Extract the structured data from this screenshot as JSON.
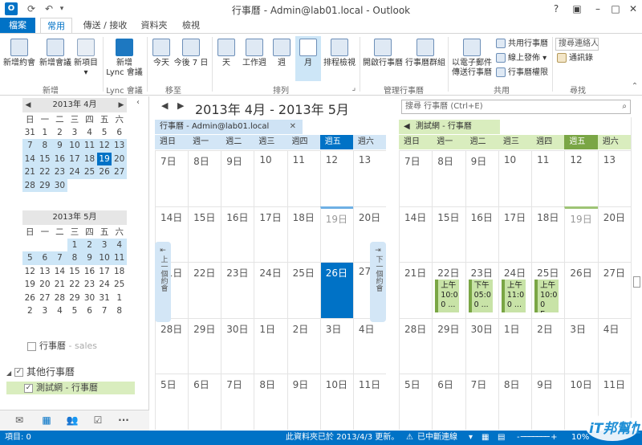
{
  "window": {
    "title": "行事曆 - Admin@lab01.local - Outlook",
    "app_icon": "O",
    "buttons": [
      "?",
      "▣",
      "–",
      "□",
      "✕"
    ]
  },
  "tabs": [
    {
      "label": "檔案"
    },
    {
      "label": "常用"
    },
    {
      "label": "傳送 / 接收"
    },
    {
      "label": "資料夾"
    },
    {
      "label": "檢視"
    }
  ],
  "ribbon": {
    "new_group": {
      "label": "新增",
      "buttons": [
        "新增約會",
        "新增會議",
        "新項目"
      ]
    },
    "lync_group": {
      "label": "Lync 會議",
      "buttons": [
        "新增",
        "Lync 會議"
      ]
    },
    "goto_group": {
      "label": "移至",
      "buttons": [
        "今天",
        "今後 7 日"
      ]
    },
    "arrange_group": {
      "label": "排列",
      "buttons": [
        "天",
        "工作週",
        "週",
        "月",
        "排程檢視"
      ]
    },
    "manage_group": {
      "label": "管理行事曆",
      "buttons": [
        "開啟行事曆",
        "行事曆群組"
      ]
    },
    "share_group": {
      "label": "共用",
      "buttons": [
        "以電子郵件",
        "傳送行事曆"
      ],
      "small": [
        "共用行事曆",
        "線上發佈",
        "行事曆權限"
      ]
    },
    "find_group": {
      "label": "尋找",
      "search": "搜尋連絡人",
      "addressbook": "通訊錄"
    }
  },
  "mini_april": {
    "title": "2013年 4月",
    "weekdays": [
      "日",
      "一",
      "二",
      "三",
      "四",
      "五",
      "六"
    ],
    "rows": [
      [
        "31",
        "1",
        "2",
        "3",
        "4",
        "5",
        "6"
      ],
      [
        "7",
        "8",
        "9",
        "10",
        "11",
        "12",
        "13"
      ],
      [
        "14",
        "15",
        "16",
        "17",
        "18",
        "19",
        "20"
      ],
      [
        "21",
        "22",
        "23",
        "24",
        "25",
        "26",
        "27"
      ],
      [
        "28",
        "29",
        "30",
        "",
        "",
        "",
        ""
      ]
    ]
  },
  "mini_may": {
    "title": "2013年 5月",
    "weekdays": [
      "日",
      "一",
      "二",
      "三",
      "四",
      "五",
      "六"
    ],
    "rows": [
      [
        "",
        "",
        "",
        "1",
        "2",
        "3",
        "4"
      ],
      [
        "5",
        "6",
        "7",
        "8",
        "9",
        "10",
        "11"
      ],
      [
        "12",
        "13",
        "14",
        "15",
        "16",
        "17",
        "18"
      ],
      [
        "19",
        "20",
        "21",
        "22",
        "23",
        "24",
        "25"
      ],
      [
        "26",
        "27",
        "28",
        "29",
        "30",
        "31",
        "1"
      ],
      [
        "2",
        "3",
        "4",
        "5",
        "6",
        "7",
        "8"
      ]
    ]
  },
  "folders": {
    "my_calendar": "行事曆",
    "my_calendar_suffix": "- sales",
    "other_group": "其他行事曆",
    "other_item": "測試網 - 行事曆"
  },
  "main": {
    "range": "2013年 4月 - 2013年 5月",
    "search_placeholder": "搜尋 行事曆 (Ctrl+E)"
  },
  "cal_left": {
    "tab": "行事曆 - Admin@lab01.local",
    "days": [
      "週日",
      "週一",
      "週二",
      "週三",
      "週四",
      "週五",
      "週六"
    ],
    "weeks": [
      [
        "7日",
        "8日",
        "9日",
        "10",
        "11",
        "12",
        "13"
      ],
      [
        "14日",
        "15日",
        "16日",
        "17日",
        "18日",
        "19日",
        "20日"
      ],
      [
        "21日",
        "22日",
        "23日",
        "24日",
        "25日",
        "26日",
        "27"
      ],
      [
        "28日",
        "29日",
        "30日",
        "1日",
        "2日",
        "3日",
        "4日"
      ],
      [
        "5日",
        "6日",
        "7日",
        "8日",
        "9日",
        "10日",
        "11日"
      ]
    ],
    "prev_handle": "上一個約會",
    "next_handle": "下一個約會"
  },
  "cal_right": {
    "tab": "測試網 - 行事曆",
    "days": [
      "週日",
      "週一",
      "週二",
      "週三",
      "週四",
      "週五",
      "週六"
    ],
    "weeks": [
      [
        "7日",
        "8日",
        "9日",
        "10",
        "11",
        "12",
        "13"
      ],
      [
        "14日",
        "15日",
        "16日",
        "17日",
        "18日",
        "19日",
        "20日"
      ],
      [
        "21日",
        "22日",
        "23日",
        "24日",
        "25日",
        "26日",
        "27日"
      ],
      [
        "28日",
        "29日",
        "30日",
        "1日",
        "2日",
        "3日",
        "4日"
      ],
      [
        "5日",
        "6日",
        "7日",
        "8日",
        "9日",
        "10日",
        "11日"
      ]
    ],
    "appointments": [
      {
        "day": "週一",
        "text": "上午\n10:0\n0 ..."
      },
      {
        "day": "週二",
        "text": "下午\n05:0\n0 ..."
      },
      {
        "day": "週三",
        "text": "上午\n11:0\n0 ..."
      },
      {
        "day": "週四",
        "text": "上午\n10:0\n0 E..."
      }
    ]
  },
  "status": {
    "items": "項目: 0",
    "updated": "此資料夾已於 2013/4/3 更新。",
    "connection": "已中斷連線",
    "zoom": "10%"
  },
  "watermark": "iT邦幫忙",
  "colors": {
    "accent": "#0072c6",
    "left_header": "#d3e6f6",
    "right_header": "#d9edbe",
    "appt": "#c8e3a7"
  }
}
